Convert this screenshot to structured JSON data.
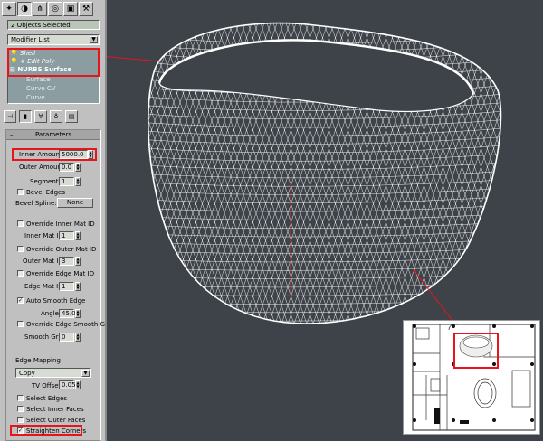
{
  "command_panel": {
    "tabs": [
      {
        "name": "create-tab",
        "glyph": "✦"
      },
      {
        "name": "modify-tab",
        "glyph": "◑"
      },
      {
        "name": "hierarchy-tab",
        "glyph": "⋔"
      },
      {
        "name": "motion-tab",
        "glyph": "◎"
      },
      {
        "name": "display-tab",
        "glyph": "▣"
      },
      {
        "name": "utilities-tab",
        "glyph": "⚒"
      }
    ],
    "selection_label": "2 Objects Selected",
    "modifier_list": "Modifier List",
    "stack": {
      "items": [
        "Shell",
        "Edit Poly",
        "NURBS Surface"
      ],
      "sub_items": [
        "Surface",
        "Curve CV",
        "Curve"
      ]
    }
  },
  "parameters": {
    "title": "Parameters",
    "inner_amount": {
      "label": "Inner Amount:",
      "value": "5000.0"
    },
    "outer_amount": {
      "label": "Outer Amount:",
      "value": "0.0"
    },
    "segments": {
      "label": "Segments:",
      "value": "1"
    },
    "bevel_edges": {
      "label": "Bevel Edges",
      "checked": false
    },
    "bevel_spline": {
      "label": "Bevel Spline:",
      "button": "None"
    },
    "override_inner_mat": {
      "label": "Override Inner Mat ID",
      "checked": false
    },
    "inner_mat_id": {
      "label": "Inner Mat ID:",
      "value": "1"
    },
    "override_outer_mat": {
      "label": "Override Outer Mat ID",
      "checked": false
    },
    "outer_mat_id": {
      "label": "Outer Mat ID:",
      "value": "3"
    },
    "override_edge_mat": {
      "label": "Override Edge Mat ID",
      "checked": false
    },
    "edge_mat_id": {
      "label": "Edge Mat ID:",
      "value": "1"
    },
    "auto_smooth": {
      "label": "Auto Smooth Edge",
      "checked": true
    },
    "angle": {
      "label": "Angle:",
      "value": "45.0"
    },
    "override_smooth_grp": {
      "label": "Override Edge Smooth Grp",
      "checked": false
    },
    "smooth_grp": {
      "label": "Smooth Grp:",
      "value": "0"
    },
    "edge_mapping": {
      "label": "Edge Mapping",
      "value": "Copy"
    },
    "tv_offset": {
      "label": "TV Offset:",
      "value": "0.05"
    },
    "select_edges": {
      "label": "Select Edges",
      "checked": false
    },
    "select_inner": {
      "label": "Select Inner Faces",
      "checked": false
    },
    "select_outer": {
      "label": "Select Outer Faces",
      "checked": false
    },
    "straighten": {
      "label": "Straighten Corners",
      "checked": true
    }
  },
  "colors": {
    "highlight": "#e8141c",
    "wireframe": "#ffffff",
    "viewport_bg": "#3d4349",
    "panel_bg": "#c0c0c0"
  }
}
